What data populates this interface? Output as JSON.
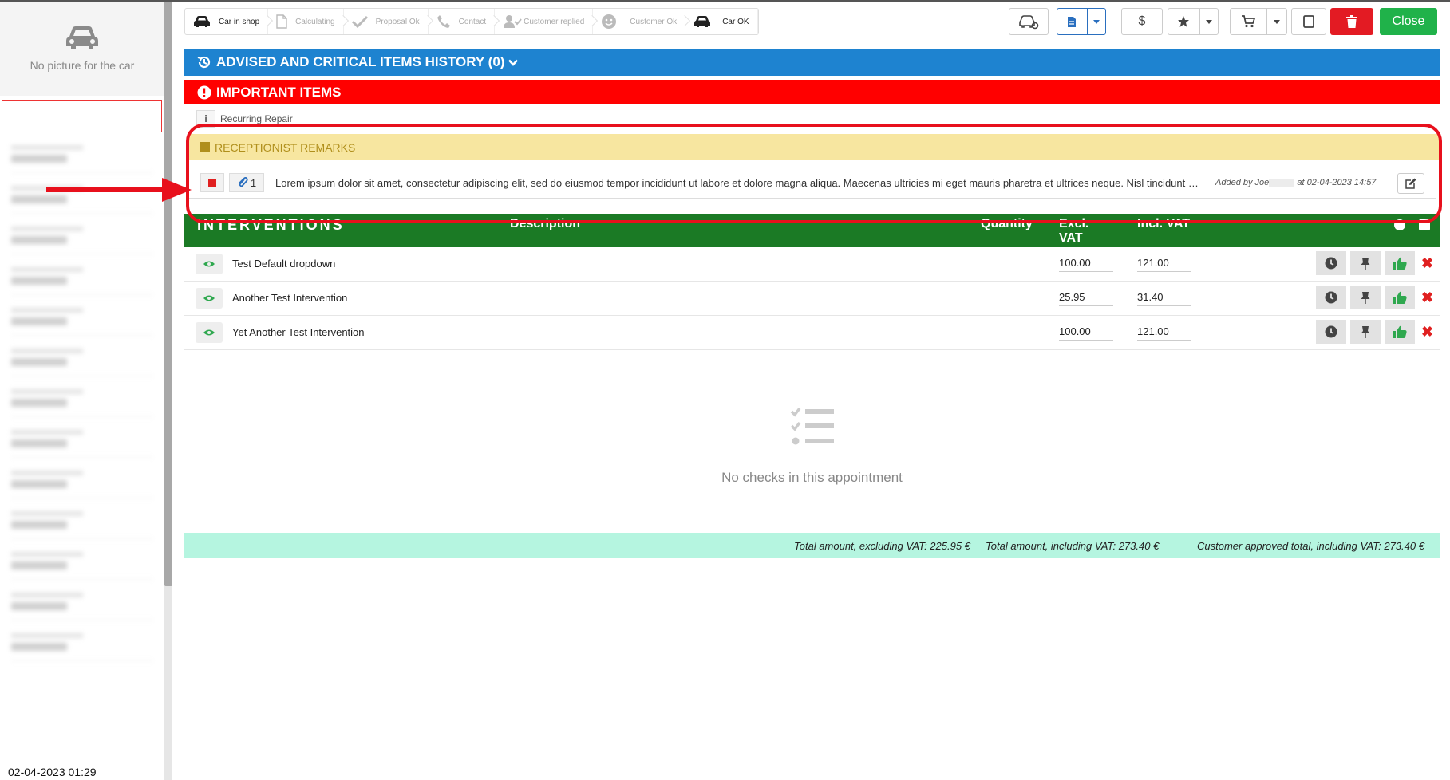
{
  "sidebar": {
    "no_picture": "No picture for the car",
    "bottom_date": "02-04-2023 01:29"
  },
  "steps": [
    {
      "label": "Car in shop",
      "icon": "car-icon",
      "active": true
    },
    {
      "label": "Calculating",
      "icon": "file-icon",
      "active": false
    },
    {
      "label": "Proposal Ok",
      "icon": "check-icon",
      "active": false
    },
    {
      "label": "Contact",
      "icon": "phone-icon",
      "active": false
    },
    {
      "label": "Customer replied",
      "icon": "user-check-icon",
      "active": false
    },
    {
      "label": "Customer Ok",
      "icon": "smile-icon",
      "active": false
    },
    {
      "label": "Car OK",
      "icon": "car-icon",
      "active": true
    }
  ],
  "toolbar": {
    "dollar": "$",
    "close_label": "Close"
  },
  "sections": {
    "history_title": "ADVISED AND CRITICAL ITEMS HISTORY (0)",
    "important_title": "IMPORTANT ITEMS",
    "recurring_info": "i",
    "recurring_label": "Recurring Repair",
    "remarks_title": "RECEPTIONIST REMARKS"
  },
  "remark": {
    "attachments": "1",
    "text": "Lorem ipsum dolor sit amet, consectetur adipiscing elit, sed do eiusmod tempor incididunt ut labore et dolore magna aliqua. Maecenas ultricies mi eget mauris pharetra et ultrices neque. Nisl tincidunt eget nullam non.",
    "added_by_prefix": "Added by Joe",
    "added_at": "at 02-04-2023 14:57"
  },
  "interventions": {
    "title": "INTERVENTIONS",
    "col_description": "Description",
    "col_quantity": "Quantity",
    "col_excl_vat": "Excl. VAT",
    "col_incl_vat": "Incl. VAT",
    "rows": [
      {
        "description": "Test Default dropdown",
        "excl_vat": "100.00",
        "incl_vat": "121.00"
      },
      {
        "description": "Another Test Intervention",
        "excl_vat": "25.95",
        "incl_vat": "31.40"
      },
      {
        "description": "Yet Another Test Intervention",
        "excl_vat": "100.00",
        "incl_vat": "121.00"
      }
    ]
  },
  "checks": {
    "empty_message": "No checks in this appointment"
  },
  "totals": {
    "excl_vat": "Total amount, excluding VAT: 225.95 €",
    "incl_vat": "Total amount, including VAT: 273.40 €",
    "approved": "Customer approved total, including VAT: 273.40 €"
  },
  "colors": {
    "history_bar": "#1e83d0",
    "important_bar": "#ff0000",
    "remarks_bar": "#f7e6a0",
    "interventions_bar": "#1b7a25",
    "totals_bar": "#b5f5e0",
    "close_button": "#20b24a",
    "delete_button": "#e31b23",
    "highlight": "#e8101c"
  }
}
